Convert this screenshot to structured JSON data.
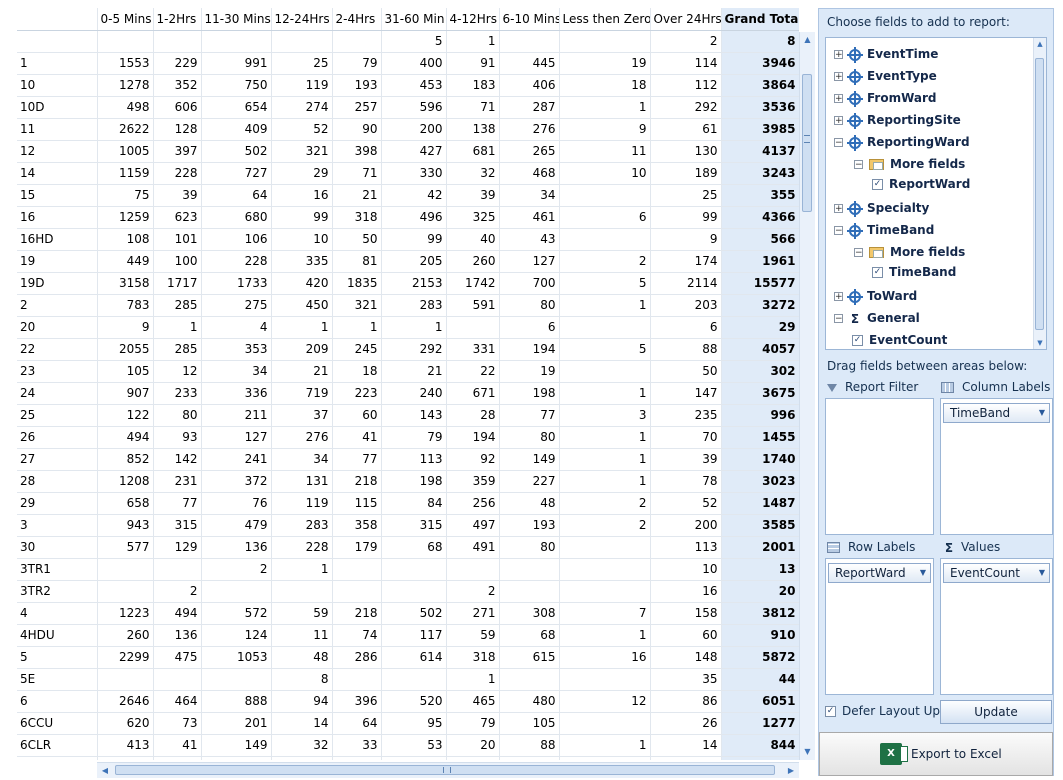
{
  "pivot": {
    "row_header": "",
    "columns": [
      "0-5 Mins",
      "1-2Hrs",
      "11-30 Mins",
      "12-24Hrs",
      "2-4Hrs",
      "31-60 Min",
      "4-12Hrs",
      "6-10 Mins",
      "Less then Zero",
      "Over 24Hrs",
      "Grand Total"
    ],
    "rows": [
      {
        "label": "",
        "cells": [
          "",
          "",
          "",
          "",
          "",
          "5",
          "1",
          "",
          "",
          "2",
          "8"
        ]
      },
      {
        "label": "1",
        "cells": [
          "1553",
          "229",
          "991",
          "25",
          "79",
          "400",
          "91",
          "445",
          "19",
          "114",
          "3946"
        ]
      },
      {
        "label": "10",
        "cells": [
          "1278",
          "352",
          "750",
          "119",
          "193",
          "453",
          "183",
          "406",
          "18",
          "112",
          "3864"
        ]
      },
      {
        "label": "10D",
        "cells": [
          "498",
          "606",
          "654",
          "274",
          "257",
          "596",
          "71",
          "287",
          "1",
          "292",
          "3536"
        ]
      },
      {
        "label": "11",
        "cells": [
          "2622",
          "128",
          "409",
          "52",
          "90",
          "200",
          "138",
          "276",
          "9",
          "61",
          "3985"
        ]
      },
      {
        "label": "12",
        "cells": [
          "1005",
          "397",
          "502",
          "321",
          "398",
          "427",
          "681",
          "265",
          "11",
          "130",
          "4137"
        ]
      },
      {
        "label": "14",
        "cells": [
          "1159",
          "228",
          "727",
          "29",
          "71",
          "330",
          "32",
          "468",
          "10",
          "189",
          "3243"
        ]
      },
      {
        "label": "15",
        "cells": [
          "75",
          "39",
          "64",
          "16",
          "21",
          "42",
          "39",
          "34",
          "",
          "25",
          "355"
        ]
      },
      {
        "label": "16",
        "cells": [
          "1259",
          "623",
          "680",
          "99",
          "318",
          "496",
          "325",
          "461",
          "6",
          "99",
          "4366"
        ]
      },
      {
        "label": "16HD",
        "cells": [
          "108",
          "101",
          "106",
          "10",
          "50",
          "99",
          "40",
          "43",
          "",
          "9",
          "566"
        ]
      },
      {
        "label": "19",
        "cells": [
          "449",
          "100",
          "228",
          "335",
          "81",
          "205",
          "260",
          "127",
          "2",
          "174",
          "1961"
        ]
      },
      {
        "label": "19D",
        "cells": [
          "3158",
          "1717",
          "1733",
          "420",
          "1835",
          "2153",
          "1742",
          "700",
          "5",
          "2114",
          "15577"
        ]
      },
      {
        "label": "2",
        "cells": [
          "783",
          "285",
          "275",
          "450",
          "321",
          "283",
          "591",
          "80",
          "1",
          "203",
          "3272"
        ]
      },
      {
        "label": "20",
        "cells": [
          "9",
          "1",
          "4",
          "1",
          "1",
          "1",
          "",
          "6",
          "",
          "6",
          "29"
        ]
      },
      {
        "label": "22",
        "cells": [
          "2055",
          "285",
          "353",
          "209",
          "245",
          "292",
          "331",
          "194",
          "5",
          "88",
          "4057"
        ]
      },
      {
        "label": "23",
        "cells": [
          "105",
          "12",
          "34",
          "21",
          "18",
          "21",
          "22",
          "19",
          "",
          "50",
          "302"
        ]
      },
      {
        "label": "24",
        "cells": [
          "907",
          "233",
          "336",
          "719",
          "223",
          "240",
          "671",
          "198",
          "1",
          "147",
          "3675"
        ]
      },
      {
        "label": "25",
        "cells": [
          "122",
          "80",
          "211",
          "37",
          "60",
          "143",
          "28",
          "77",
          "3",
          "235",
          "996"
        ]
      },
      {
        "label": "26",
        "cells": [
          "494",
          "93",
          "127",
          "276",
          "41",
          "79",
          "194",
          "80",
          "1",
          "70",
          "1455"
        ]
      },
      {
        "label": "27",
        "cells": [
          "852",
          "142",
          "241",
          "34",
          "77",
          "113",
          "92",
          "149",
          "1",
          "39",
          "1740"
        ]
      },
      {
        "label": "28",
        "cells": [
          "1208",
          "231",
          "372",
          "131",
          "218",
          "198",
          "359",
          "227",
          "1",
          "78",
          "3023"
        ]
      },
      {
        "label": "29",
        "cells": [
          "658",
          "77",
          "76",
          "119",
          "115",
          "84",
          "256",
          "48",
          "2",
          "52",
          "1487"
        ]
      },
      {
        "label": "3",
        "cells": [
          "943",
          "315",
          "479",
          "283",
          "358",
          "315",
          "497",
          "193",
          "2",
          "200",
          "3585"
        ]
      },
      {
        "label": "30",
        "cells": [
          "577",
          "129",
          "136",
          "228",
          "179",
          "68",
          "491",
          "80",
          "",
          "113",
          "2001"
        ]
      },
      {
        "label": "3TR1",
        "cells": [
          "",
          "",
          "2",
          "1",
          "",
          "",
          "",
          "",
          "",
          "10",
          "13"
        ]
      },
      {
        "label": "3TR2",
        "cells": [
          "",
          "2",
          "",
          "",
          "",
          "",
          "2",
          "",
          "",
          "16",
          "20"
        ]
      },
      {
        "label": "4",
        "cells": [
          "1223",
          "494",
          "572",
          "59",
          "218",
          "502",
          "271",
          "308",
          "7",
          "158",
          "3812"
        ]
      },
      {
        "label": "4HDU",
        "cells": [
          "260",
          "136",
          "124",
          "11",
          "74",
          "117",
          "59",
          "68",
          "1",
          "60",
          "910"
        ]
      },
      {
        "label": "5",
        "cells": [
          "2299",
          "475",
          "1053",
          "48",
          "286",
          "614",
          "318",
          "615",
          "16",
          "148",
          "5872"
        ]
      },
      {
        "label": "5E",
        "cells": [
          "",
          "",
          "",
          "8",
          "",
          "",
          "1",
          "",
          "",
          "35",
          "44"
        ]
      },
      {
        "label": "6",
        "cells": [
          "2646",
          "464",
          "888",
          "94",
          "396",
          "520",
          "465",
          "480",
          "12",
          "86",
          "6051"
        ]
      },
      {
        "label": "6CCU",
        "cells": [
          "620",
          "73",
          "201",
          "14",
          "64",
          "95",
          "79",
          "105",
          "",
          "26",
          "1277"
        ]
      },
      {
        "label": "6CLR",
        "cells": [
          "413",
          "41",
          "149",
          "32",
          "33",
          "53",
          "20",
          "88",
          "1",
          "14",
          "844"
        ]
      },
      {
        "label": "",
        "cells": [
          "",
          "",
          "",
          "",
          "",
          "",
          "",
          "",
          "",
          "",
          ""
        ]
      }
    ]
  },
  "field_list": {
    "title": "Choose fields to add to report:",
    "fields": [
      {
        "label": "EventTime",
        "kind": "dimension",
        "expander": "+"
      },
      {
        "label": "EventType",
        "kind": "dimension",
        "expander": "+"
      },
      {
        "label": "FromWard",
        "kind": "dimension",
        "expander": "+"
      },
      {
        "label": "ReportingSite",
        "kind": "dimension",
        "expander": "+"
      },
      {
        "label": "ReportingWard",
        "kind": "dimension",
        "expander": "−"
      },
      {
        "label": "More fields",
        "kind": "folder",
        "expander": "−"
      },
      {
        "label": "ReportWard",
        "kind": "field",
        "checked": true
      },
      {
        "label": "Specialty",
        "kind": "dimension",
        "expander": "+"
      },
      {
        "label": "TimeBand",
        "kind": "dimension",
        "expander": "−"
      },
      {
        "label": "More fields",
        "kind": "folder",
        "expander": "−"
      },
      {
        "label": "TimeBand",
        "kind": "field",
        "checked": true
      },
      {
        "label": "ToWard",
        "kind": "dimension",
        "expander": "+"
      },
      {
        "label": "General",
        "kind": "measure-group",
        "expander": "−"
      },
      {
        "label": "EventCount",
        "kind": "field",
        "checked": true
      }
    ],
    "drag_title": "Drag fields between areas below:",
    "areas": {
      "report_filter": {
        "label": "Report Filter",
        "items": []
      },
      "column_labels": {
        "label": "Column Labels",
        "items": [
          "TimeBand"
        ]
      },
      "row_labels": {
        "label": "Row Labels",
        "items": [
          "ReportWard"
        ]
      },
      "values": {
        "label": "Values",
        "items": [
          "EventCount"
        ]
      }
    },
    "defer_label": "Defer Layout Update",
    "defer_checked": true,
    "update_label": "Update",
    "export_label": "Export to Excel",
    "export_icon_text": "X"
  },
  "icons": {
    "expand_plus": "+",
    "collapse_minus": "−",
    "check": "✓",
    "sigma": "Σ",
    "dropdown": "▼",
    "up": "▲",
    "down": "▼",
    "left": "◀",
    "right": "▶"
  },
  "colors": {
    "grand_total_bg": "#e0ebf8",
    "panel_bg": "#dce9f8",
    "dimension_icon": "#2f6db8",
    "excel_green": "#1e7145"
  }
}
